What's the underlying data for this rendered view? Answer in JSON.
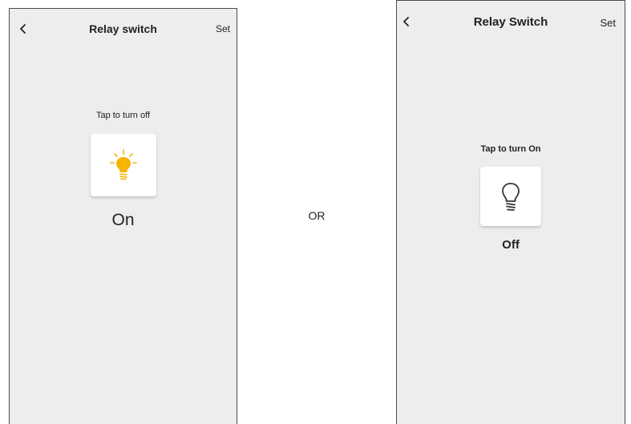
{
  "screens": [
    {
      "title": "Relay switch",
      "set_label": "Set",
      "hint": "Tap to turn off",
      "state_label": "On",
      "is_on": true,
      "bulb_color": "#f5b400"
    },
    {
      "title": "Relay Switch",
      "set_label": "Set",
      "hint": "Tap to turn On",
      "state_label": "Off",
      "is_on": false,
      "bulb_color": "#333333"
    }
  ],
  "separator": "OR",
  "icons": {
    "back": "chevron-left-icon",
    "bulb_on": "lightbulb-on-icon",
    "bulb_off": "lightbulb-off-icon"
  },
  "colors": {
    "screen_bg": "#ededed",
    "tile_bg": "#ffffff",
    "accent_on": "#f5b400"
  }
}
